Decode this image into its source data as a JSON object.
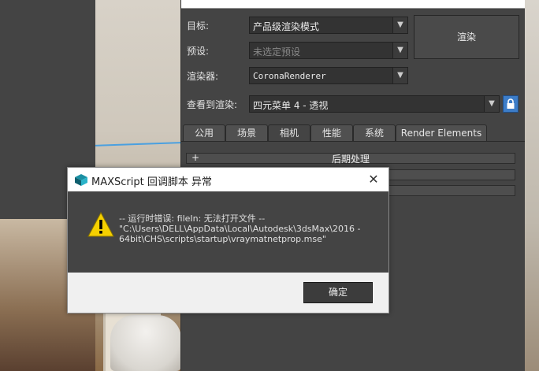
{
  "render_setup": {
    "target_label": "目标:",
    "target_value": "产品级渲染模式",
    "preset_label": "预设:",
    "preset_value": "未选定预设",
    "renderer_label": "渲染器:",
    "renderer_value": "CoronaRenderer",
    "view_label": "查看到渲染:",
    "view_value": "四元菜单 4 - 透视",
    "render_button": "渲染",
    "tabs": [
      "公用",
      "场景",
      "相机",
      "性能",
      "系统",
      "Render Elements"
    ],
    "active_tab": "相机",
    "rollout_label": "后期处理",
    "rollout_toggle": "+"
  },
  "dialog": {
    "title": "MAXScript 回调脚本 异常",
    "close_glyph": "✕",
    "message_lines": [
      "-- 运行时错误: fileIn: 无法打开文件 --",
      "\"C:\\Users\\DELL\\AppData\\Local\\Autodesk\\3dsMax\\2016 -",
      "64bit\\CHS\\scripts\\startup\\vraymatnetprop.mse\""
    ],
    "ok_button": "确定",
    "icon": "warning-icon"
  },
  "colors": {
    "panel_bg": "#444444",
    "accent_blue": "#3d7dc8",
    "warning_yellow": "#f5d000"
  }
}
